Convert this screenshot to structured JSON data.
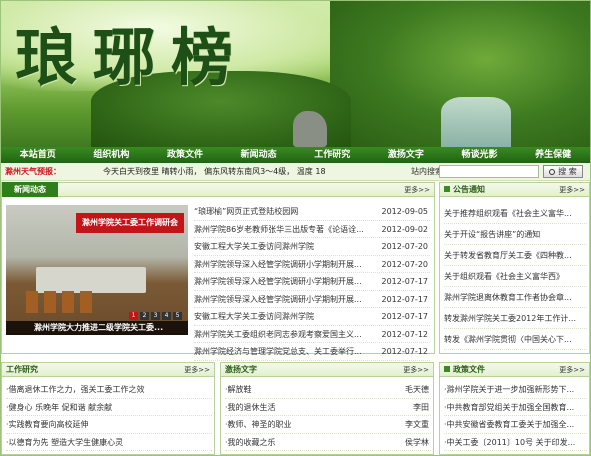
{
  "site": {
    "logo_text": "琅琊榜"
  },
  "nav": {
    "items": [
      "本站首页",
      "组织机构",
      "政策文件",
      "新闻动态",
      "工作研究",
      "激扬文字",
      "畅谈光影",
      "养生保健"
    ]
  },
  "weather": {
    "label": "滁州天气预报：",
    "text": "今天白天到夜里 晴转小雨， 偏东风转东南风3～4级， 温度 18"
  },
  "search": {
    "label": "站内搜索：",
    "placeholder": "",
    "button": "搜 索"
  },
  "news": {
    "title": "新闻动态",
    "more": "更多>>",
    "photo_banner": "滁州学院关工委工作调研会",
    "photo_caption": "滁州学院大力推进二级学院关工委...",
    "photo_dots": [
      "1",
      "2",
      "3",
      "4",
      "5"
    ],
    "items": [
      {
        "title": "“琅琊榆”网页正式登陆校园网",
        "date": "2012-09-05"
      },
      {
        "title": "滁州学院86岁老教师张华三出版专著《论语诠...",
        "date": "2012-09-02"
      },
      {
        "title": "安徽工程大学关工委访问滁州学院",
        "date": "2012-07-20"
      },
      {
        "title": "滁州学院领导深入经管学院调研小学期制开展...",
        "date": "2012-07-20"
      },
      {
        "title": "滁州学院领导深入经管学院调研小学期制开展...",
        "date": "2012-07-17"
      },
      {
        "title": "滁州学院领导深入经管学院调研小学期制开展...",
        "date": "2012-07-17"
      },
      {
        "title": "安徽工程大学关工委访问滁州学院",
        "date": "2012-07-17"
      },
      {
        "title": "滁州学院关工委组织老同志参观考察爱国主义...",
        "date": "2012-07-12"
      },
      {
        "title": "滁州学院经济与管理学院党总支、关工委举行...",
        "date": "2012-07-12"
      }
    ]
  },
  "notice": {
    "title": "公告通知",
    "more": "更多>>",
    "items": [
      "关于推荐组织观看《社会主义富华...",
      "关于开设“报告讲座”的通知",
      "关于转发省教育厅关工委《四种教...",
      "关于组织观看《社会主义富华西》",
      "滁州学院退离休教育工作者协会章...",
      "转发滁州学院关工委2012年工作计...",
      "转发《滁州学院贯彻〈中国关心下..."
    ]
  },
  "work": {
    "title": "工作研究",
    "more": "更多>>",
    "items": [
      "·借离退休工作之力，强关工委工作之效",
      "·健身心 乐晚年 促和谐 献余献",
      "·实践教育要向高校延伸",
      "·以德育为先 塑造大学生健康心灵"
    ]
  },
  "words": {
    "title": "激扬文字",
    "more": "更多>>",
    "items": [
      {
        "title": "·解放鞋",
        "author": "毛天德"
      },
      {
        "title": "·我的退休生活",
        "author": "李田"
      },
      {
        "title": "·教师、神圣的职业",
        "author": "李文重"
      },
      {
        "title": "·我的收藏之乐",
        "author": "侯学林"
      }
    ]
  },
  "policy": {
    "title": "政策文件",
    "more": "更多>>",
    "items": [
      "·滁州学院关于进一步加强新形势下...",
      "·中共教育部党组关于加强全国教育...",
      "·中共安徽省委教育工委关于加强全...",
      "·中关工委〔2011〕10号 关于印发..."
    ]
  },
  "colors": {
    "nav_bg": "#1f6412",
    "accent_red": "#c3141a",
    "panel_border": "#b7d39a"
  }
}
